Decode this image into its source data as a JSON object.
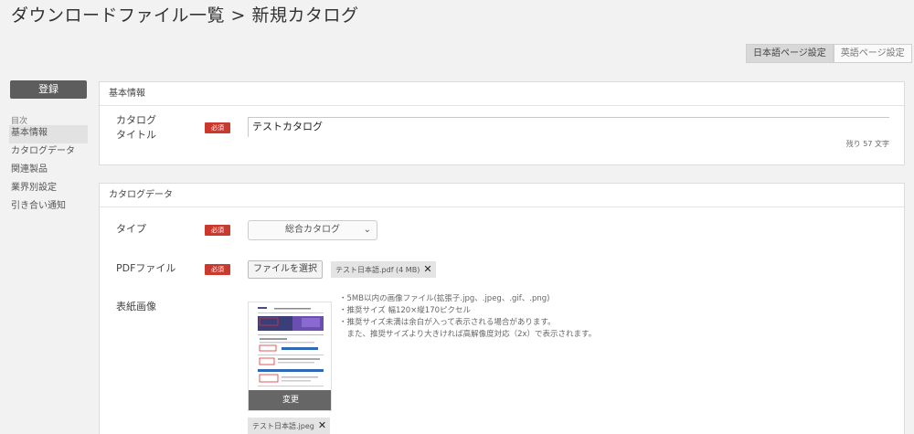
{
  "page_title": "ダウンロードファイル一覧 > 新規カタログ",
  "lang_tabs": [
    {
      "label": "日本語ページ設定",
      "active": true
    },
    {
      "label": "英語ページ設定",
      "active": false
    }
  ],
  "register_button": "登録",
  "sidebar": {
    "heading": "目次",
    "items": [
      {
        "label": "基本情報",
        "active": true
      },
      {
        "label": "カタログデータ",
        "active": false
      },
      {
        "label": "関連製品",
        "active": false
      },
      {
        "label": "業界別設定",
        "active": false
      },
      {
        "label": "引き合い通知",
        "active": false
      }
    ]
  },
  "basic_info": {
    "header": "基本情報",
    "title_label_line1": "カタログ",
    "title_label_line2": "タイトル",
    "required": "必須",
    "title_value": "テストカタログ",
    "char_count": "残り 57 文字"
  },
  "catalog_data": {
    "header": "カタログデータ",
    "type_label": "タイプ",
    "required": "必須",
    "type_value": "総合カタログ",
    "pdf_label": "PDFファイル",
    "file_button": "ファイルを選択",
    "pdf_file": "テスト日本語.pdf (4 MB)",
    "cover_label": "表紙画像",
    "change_button": "変更",
    "cover_file": "テスト日本語.jpeg",
    "notes": [
      "・5MB以内の画像ファイル(拡張子.jpg、.jpeg、.gif、.png)",
      "・推奨サイズ 幅120×縦170ピクセル",
      "・推奨サイズ未満は余白が入って表示される場合があります。",
      "　また、推奨サイズより大きければ高解像度対応（2x）で表示されます。"
    ]
  }
}
